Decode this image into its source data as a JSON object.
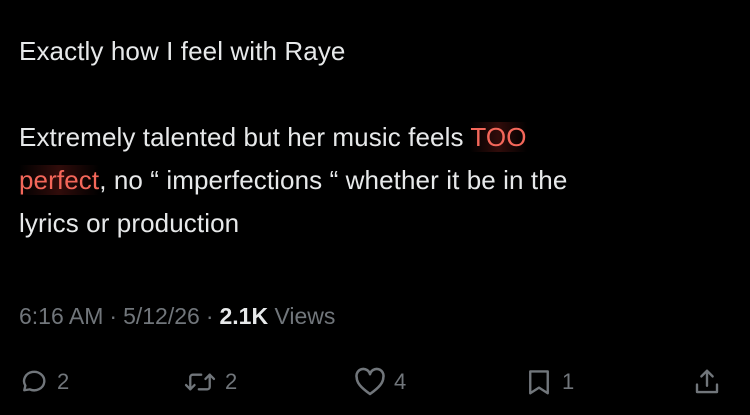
{
  "tweet": {
    "line1": "Exactly how I feel with Raye",
    "para2_part1": "Extremely talented but her music feels ",
    "para2_highlight1": "TOO",
    "para2_highlight2": "perfect",
    "para2_part2": ", no “ imperfections “ whether it be in the",
    "para2_part3": "lyrics or production"
  },
  "meta": {
    "time": "6:16 AM",
    "separator": "·",
    "date": "5/12/26",
    "views_count": "2.1K",
    "views_label": " Views"
  },
  "actions": {
    "reply": {
      "icon": "reply-icon",
      "count": "2"
    },
    "retweet": {
      "icon": "retweet-icon",
      "count": "2"
    },
    "like": {
      "icon": "heart-icon",
      "count": "4"
    },
    "bookmark": {
      "icon": "bookmark-icon",
      "count": "1"
    },
    "share": {
      "icon": "share-icon"
    }
  },
  "colors": {
    "background": "#000000",
    "text": "#e7e9ea",
    "secondary": "#71767b",
    "highlight": "#f4675a"
  }
}
